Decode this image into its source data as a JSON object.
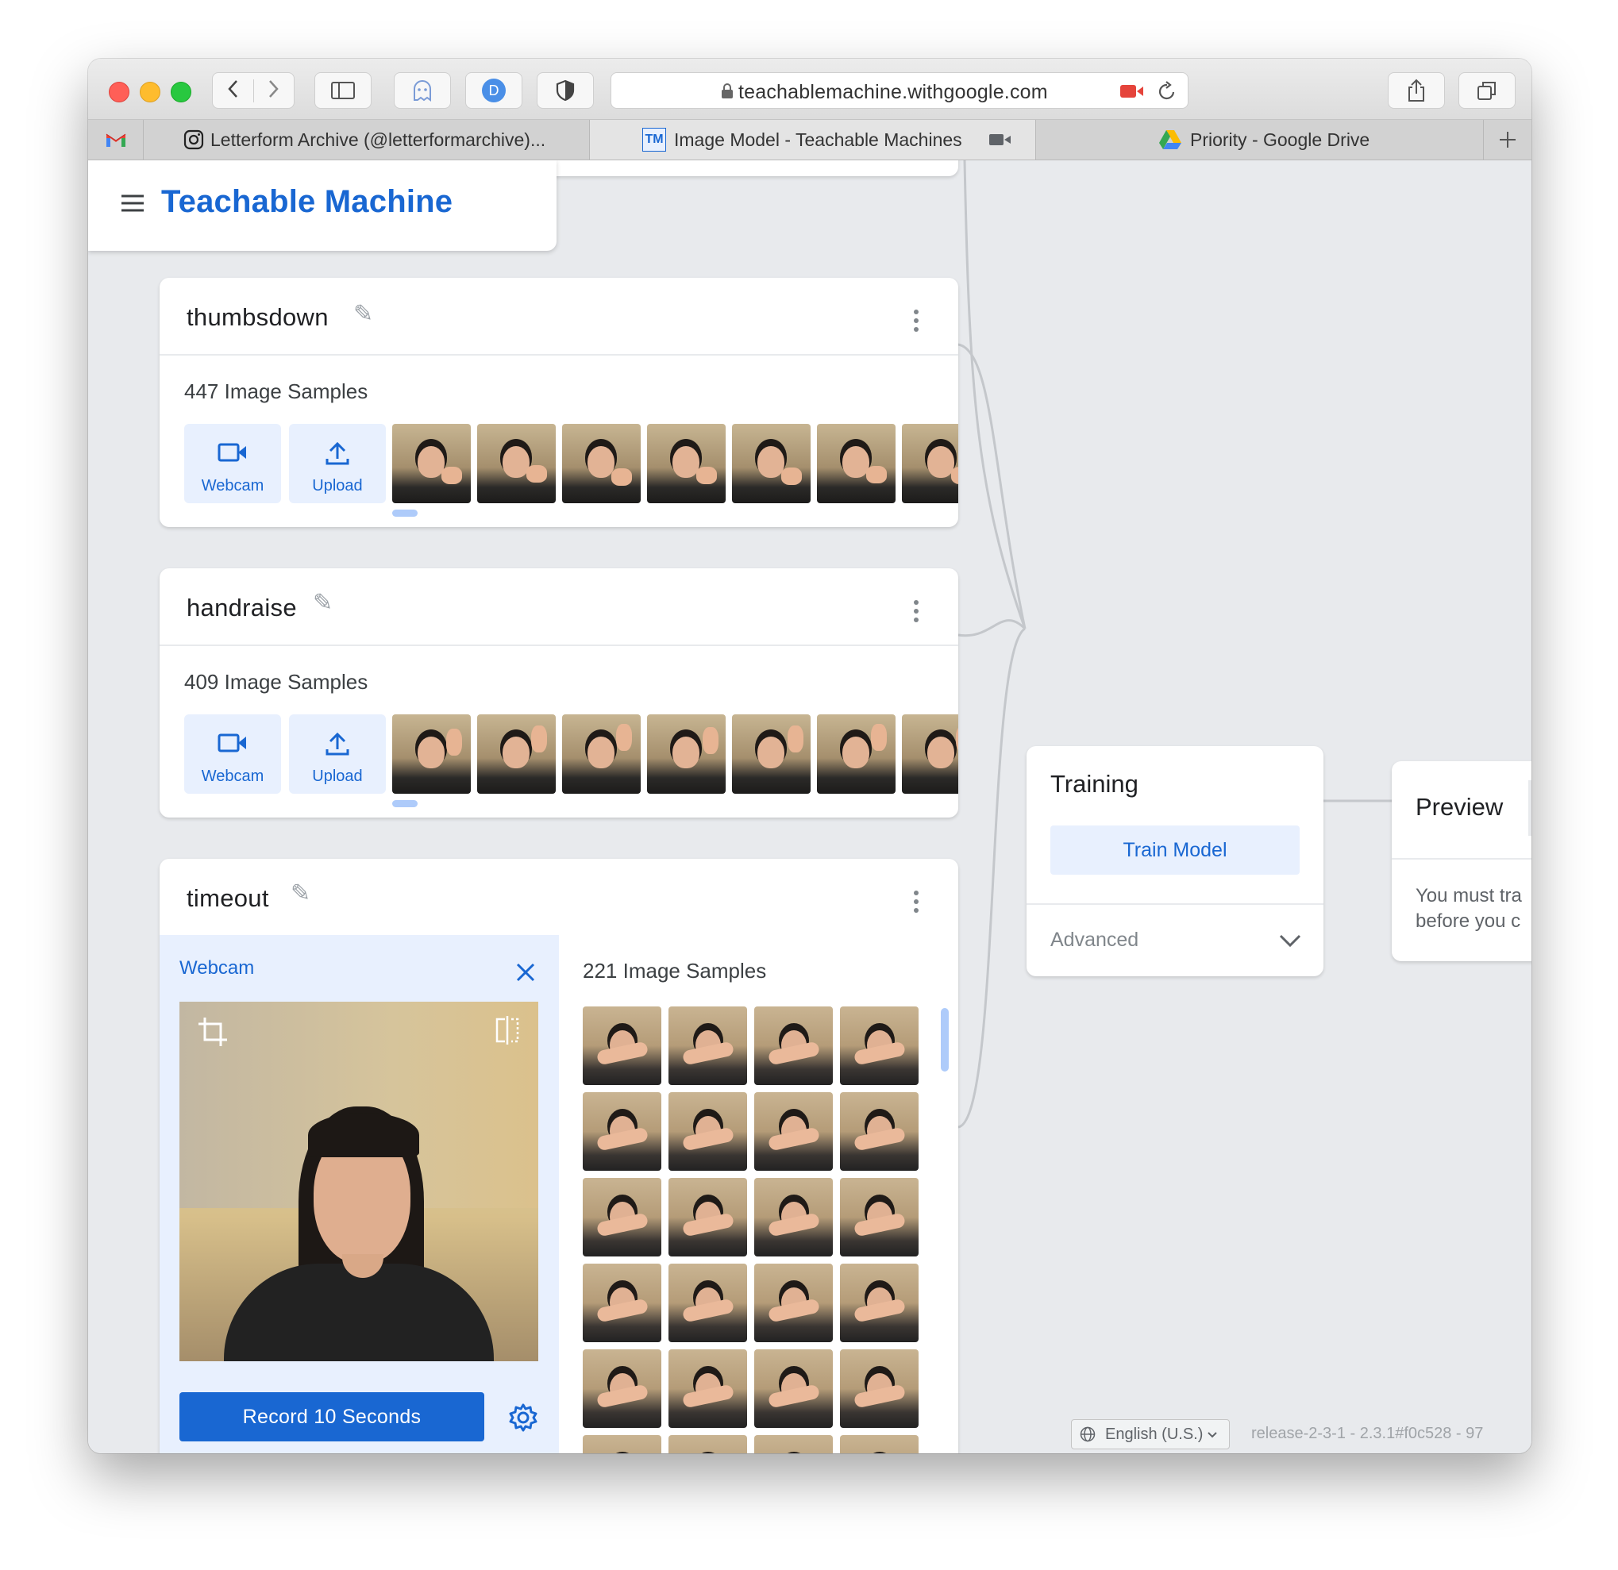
{
  "browser": {
    "url": "teachablemachine.withgoogle.com",
    "profile_initial": "D",
    "tabs": [
      {
        "label": "Letterform Archive (@letterformarchive)..."
      },
      {
        "label": "Image Model - Teachable Machines",
        "active": true
      },
      {
        "label": "Priority - Google Drive"
      }
    ]
  },
  "app": {
    "title": "Teachable Machine"
  },
  "classes": [
    {
      "name": "thumbsdown",
      "samples_label": "447 Image Samples",
      "webcam_label": "Webcam",
      "upload_label": "Upload"
    },
    {
      "name": "handraise",
      "samples_label": "409 Image Samples",
      "webcam_label": "Webcam",
      "upload_label": "Upload"
    },
    {
      "name": "timeout",
      "samples_label": "221 Image Samples",
      "webcam_panel_title": "Webcam",
      "record_label": "Record 10 Seconds"
    }
  ],
  "training": {
    "title": "Training",
    "train_button": "Train Model",
    "advanced_label": "Advanced"
  },
  "preview": {
    "title": "Preview",
    "message_line1": "You must tra",
    "message_line2": "before you c"
  },
  "footer": {
    "language": "English (U.S.)",
    "release": "release-2-3-1 - 2.3.1#f0c528 - 97"
  },
  "colors": {
    "brand_blue": "#1967d2",
    "light_blue": "#e8f0fe",
    "canvas": "#e8eaed"
  }
}
